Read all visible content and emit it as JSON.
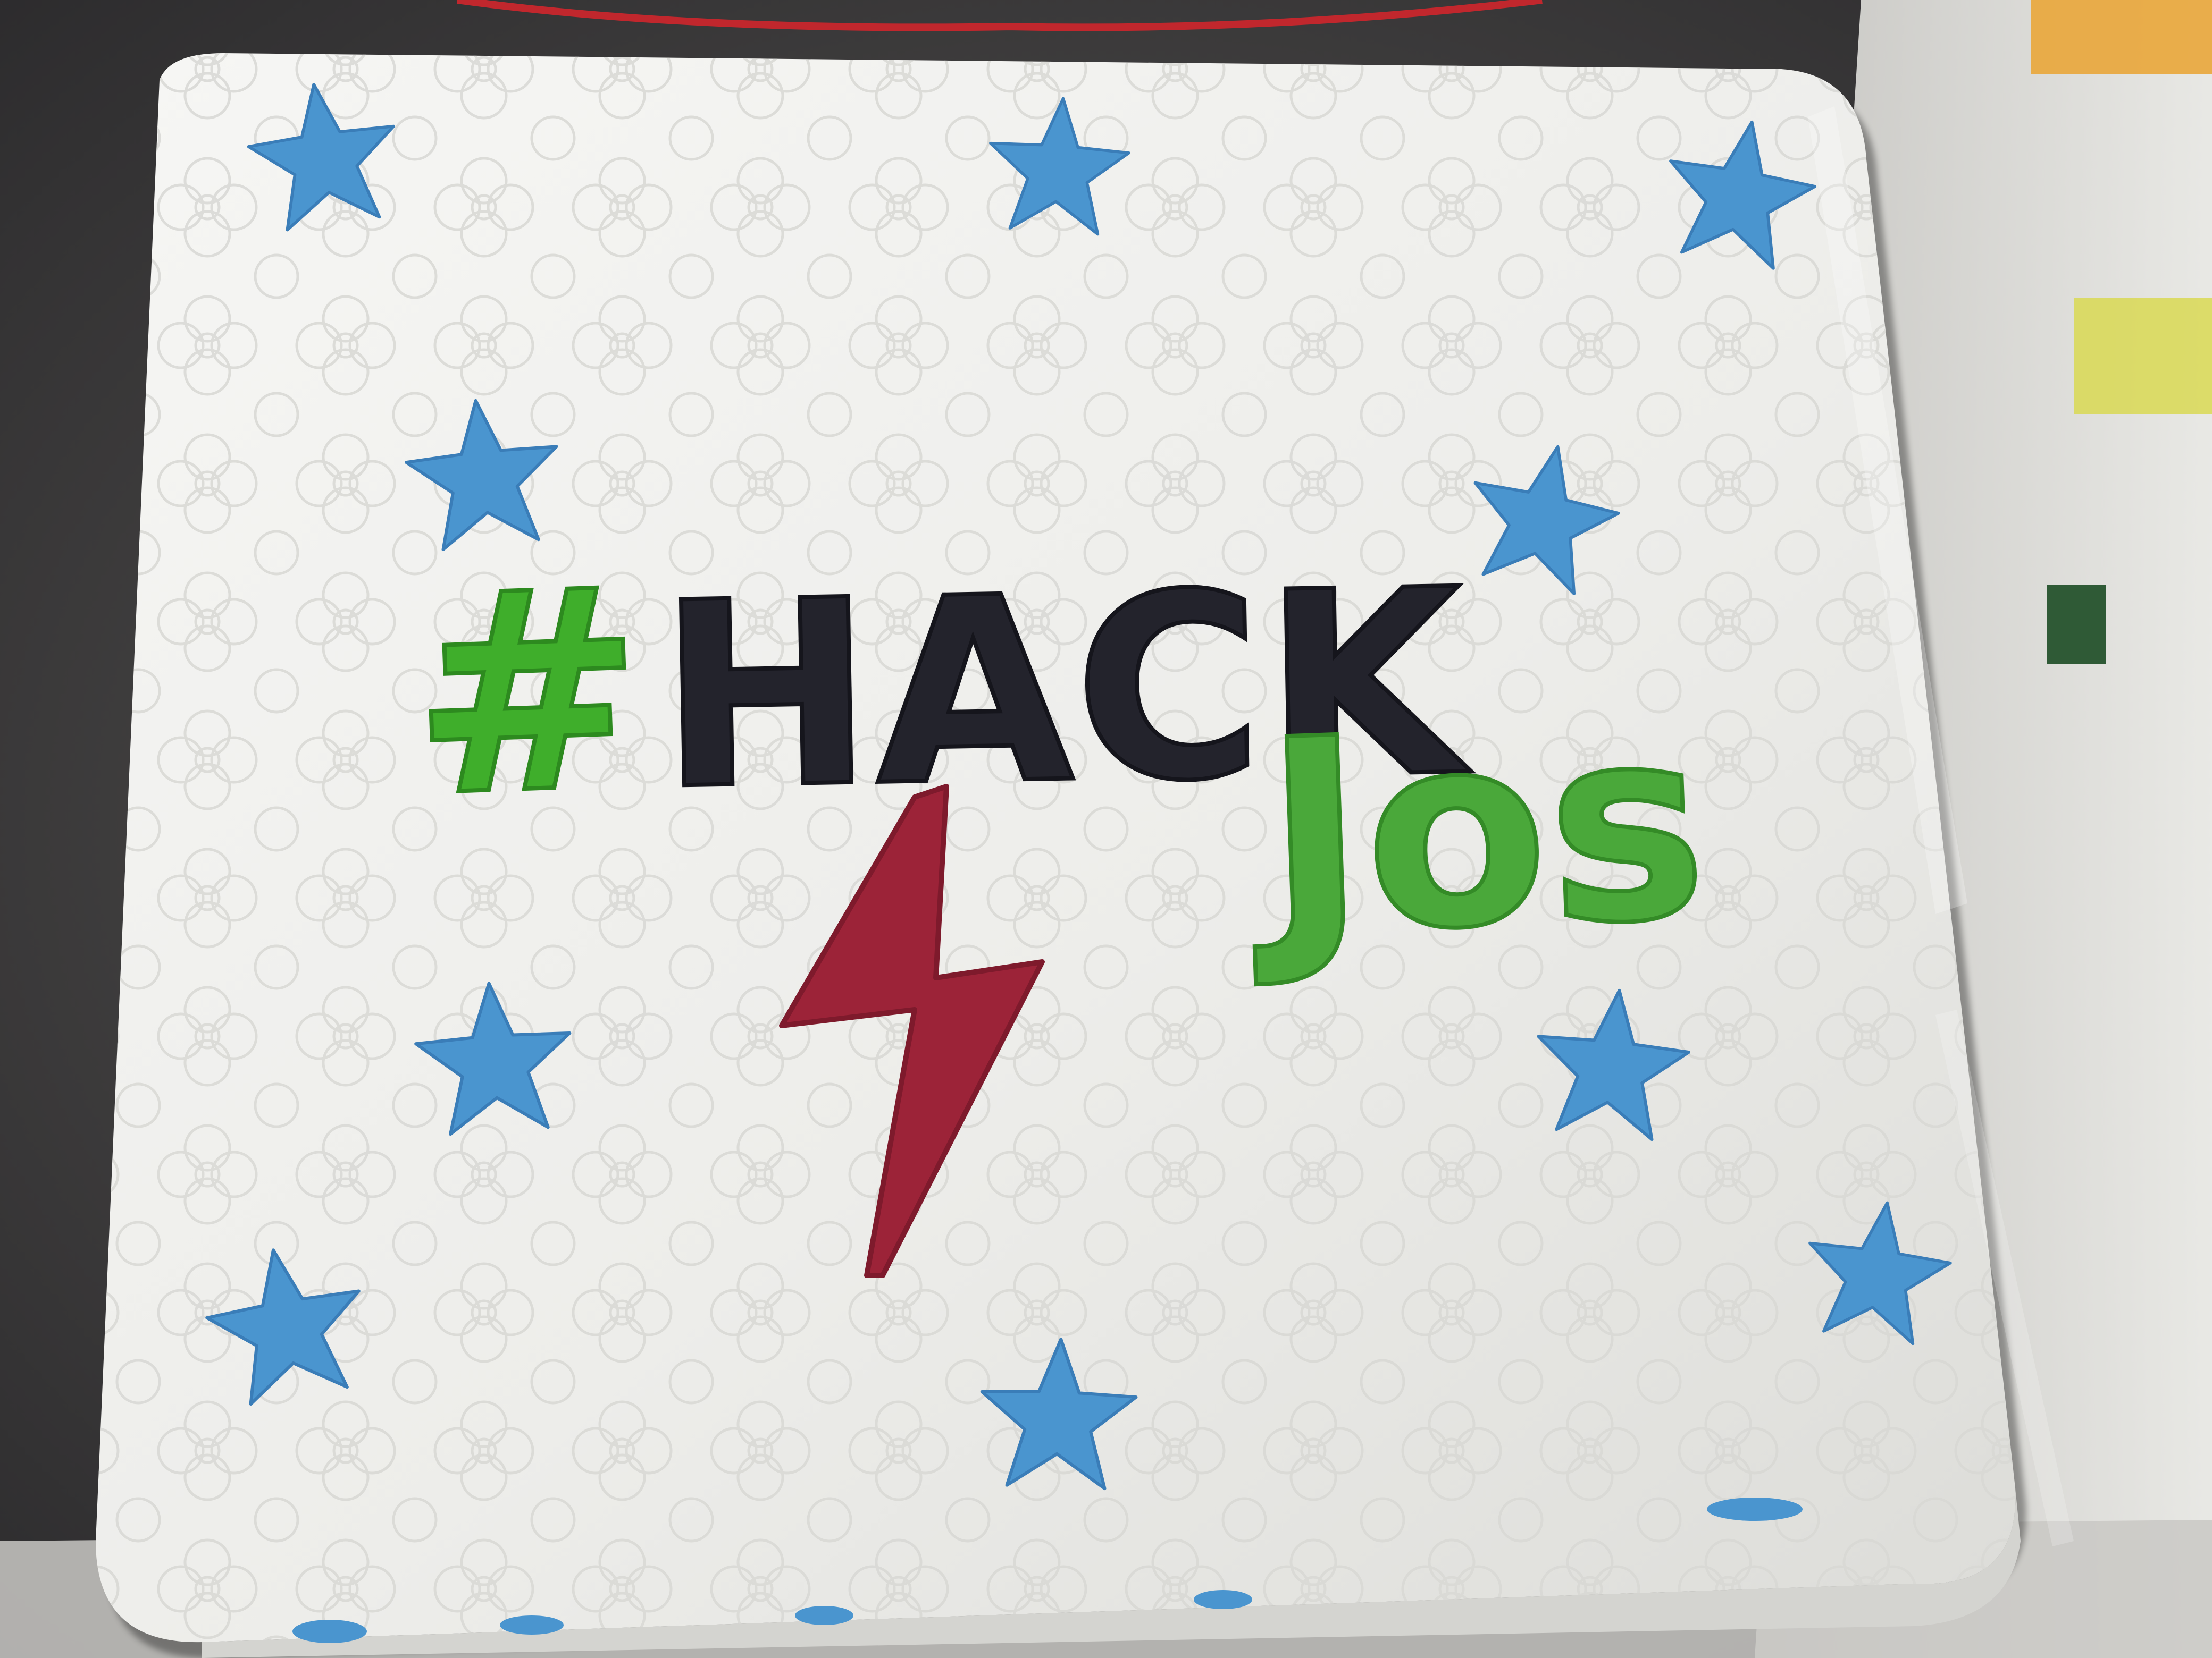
{
  "cake": {
    "hashtag_symbol": "#",
    "word_hack": "HACK",
    "word_jos": "Jos"
  },
  "colors": {
    "background_dark": "#3b3a3c",
    "fondant": "#f1f1ef",
    "star_blue": "#4a95cf",
    "hack_black": "#23232c",
    "hash_green": "#3fae2b",
    "jos_green": "#4aa83a",
    "bolt_red": "#9c2338",
    "ribbon_red": "#c1272d"
  },
  "icons": {
    "bolt": "lightning-bolt-icon",
    "star": "star-icon"
  }
}
